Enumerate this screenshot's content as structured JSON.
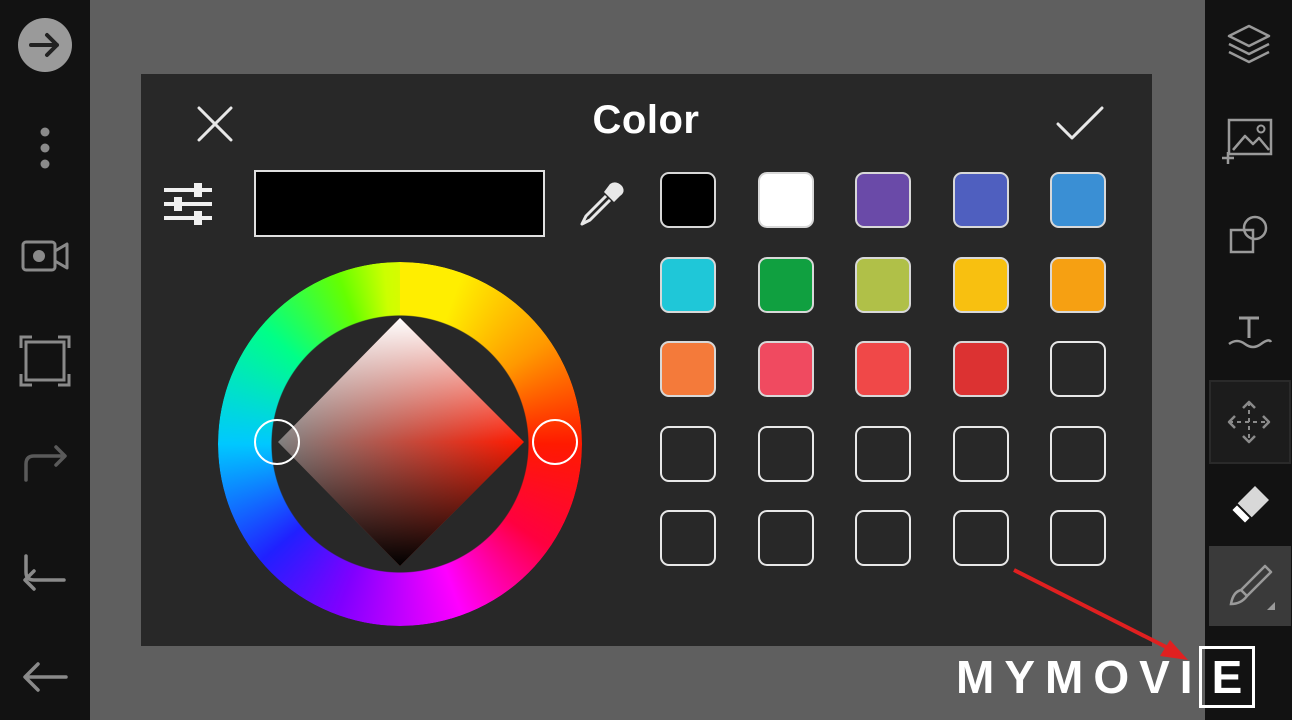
{
  "dialog": {
    "title": "Color",
    "preview_color": "#000000"
  },
  "swatches": [
    {
      "color": "#000000",
      "filled": true
    },
    {
      "color": "#ffffff",
      "filled": true
    },
    {
      "color": "#6a4aa8",
      "filled": true
    },
    {
      "color": "#4f5fbf",
      "filled": true
    },
    {
      "color": "#3a8fd4",
      "filled": true
    },
    {
      "color": "#1fc7d8",
      "filled": true
    },
    {
      "color": "#10a040",
      "filled": true
    },
    {
      "color": "#b0c048",
      "filled": true
    },
    {
      "color": "#f8c010",
      "filled": true
    },
    {
      "color": "#f6a012",
      "filled": true
    },
    {
      "color": "#f47a3a",
      "filled": true
    },
    {
      "color": "#f04a60",
      "filled": true
    },
    {
      "color": "#f04848",
      "filled": true
    },
    {
      "color": "#dc3232",
      "filled": true
    },
    {
      "color": "",
      "filled": false
    },
    {
      "color": "",
      "filled": false
    },
    {
      "color": "",
      "filled": false
    },
    {
      "color": "",
      "filled": false
    },
    {
      "color": "",
      "filled": false
    },
    {
      "color": "",
      "filled": false
    },
    {
      "color": "",
      "filled": false
    },
    {
      "color": "",
      "filled": false
    },
    {
      "color": "",
      "filled": false
    },
    {
      "color": "",
      "filled": false
    },
    {
      "color": "",
      "filled": false
    }
  ],
  "wheel": {
    "selected_hue_color": "#ff1a00"
  },
  "left_toolbar": [
    "arrow-right-circle-icon",
    "more-vertical-icon",
    "video-record-icon",
    "crop-frame-icon",
    "redo-icon",
    "undo-icon",
    "back-arrow-icon"
  ],
  "right_toolbar": [
    "layers-icon",
    "add-image-icon",
    "transform-copy-icon",
    "text-tool-icon",
    "move-icon",
    "eraser-icon",
    "brush-icon"
  ],
  "watermark": {
    "text": "MYMOVI",
    "boxed_letter": "E"
  },
  "colors": {
    "annotation_arrow": "#e02020",
    "dialog_bg": "#282828",
    "toolbar_bg": "#121212"
  }
}
